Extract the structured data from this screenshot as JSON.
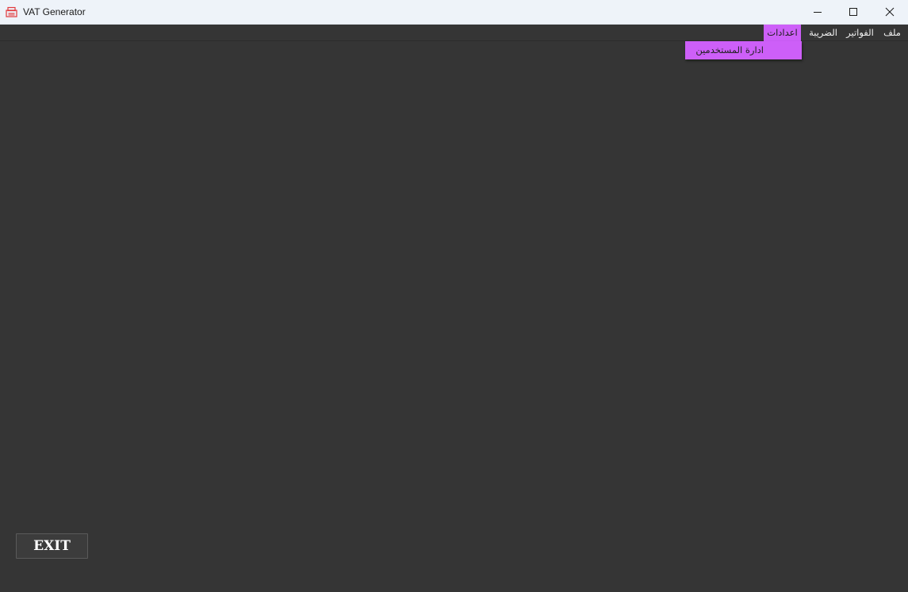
{
  "window": {
    "title": "VAT Generator",
    "icon": "app-logo-icon"
  },
  "window_controls": {
    "minimize_icon": "minimize-icon",
    "maximize_icon": "maximize-icon",
    "close_icon": "close-icon"
  },
  "menubar": {
    "items": [
      {
        "label": "ملف"
      },
      {
        "label": "الفواتير"
      },
      {
        "label": "الضريبة"
      },
      {
        "label": "اعدادات",
        "active": true
      }
    ]
  },
  "dropdown": {
    "items": [
      {
        "label": "ادارة المستخدمين"
      }
    ]
  },
  "main": {
    "exit_label": "EXIT"
  },
  "colors": {
    "background": "#353535",
    "accent": "#cd5ff8",
    "titlebar": "#eef3f9"
  }
}
